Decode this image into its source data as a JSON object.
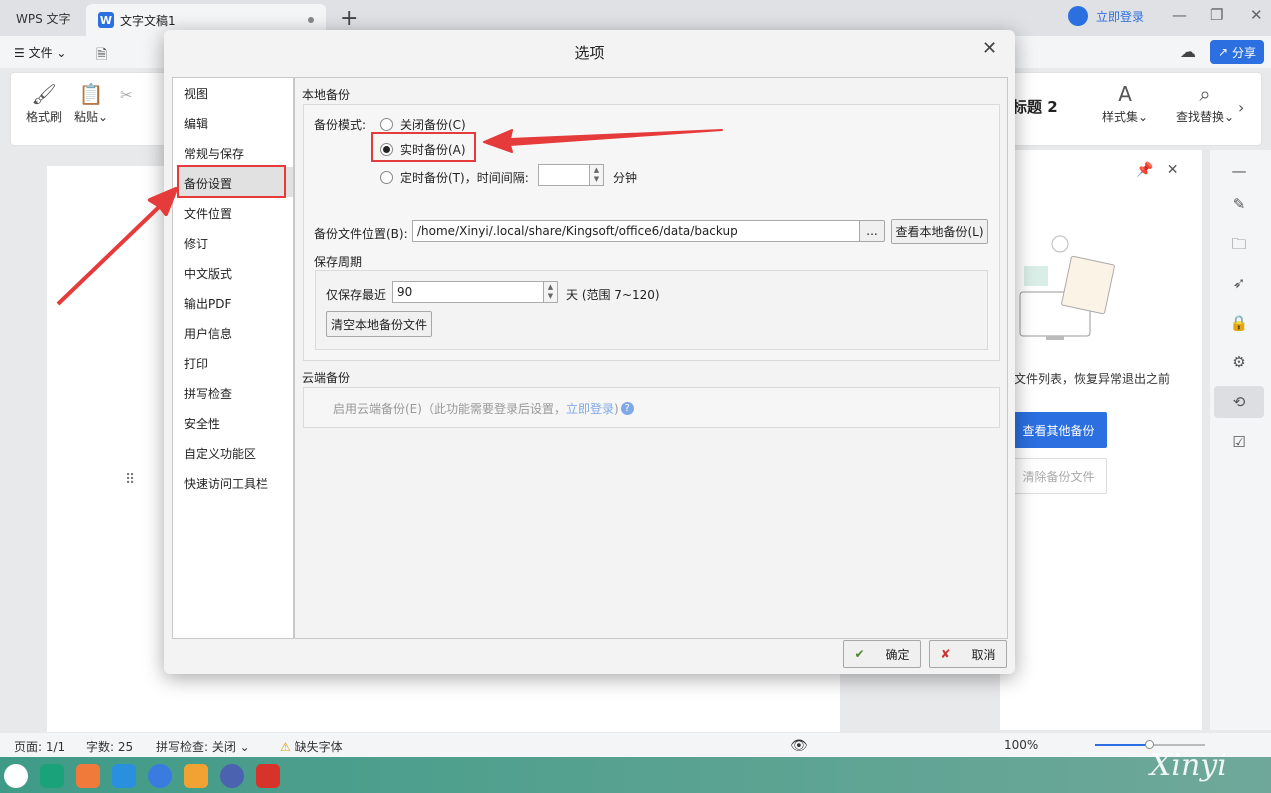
{
  "titlebar": {
    "app_tab": "WPS 文字",
    "doc_tab": "文字文稿1",
    "doc_logo": "W",
    "login": "立即登录"
  },
  "menubar": {
    "file_label": "☰ 文件 ⌄",
    "share_label": "分享"
  },
  "ribbon": {
    "format_painter": "格式刷",
    "paste": "粘贴⌄",
    "heading_style": "标题  2",
    "style_set": "样式集⌄",
    "find_replace": "查找替换⌄"
  },
  "taskpane": {
    "description": "文件列表，恢复异常退出之前",
    "view_other_backup": "查看其他备份",
    "clear_backup": "清除备份文件"
  },
  "status": {
    "page": "页面: 1/1",
    "words": "字数: 25",
    "spellcheck": "拼写检查: 关闭 ⌄",
    "missing_font": "缺失字体",
    "zoom": "100%"
  },
  "watermark": "Xinyi",
  "dialog": {
    "title": "选项",
    "nav": [
      "视图",
      "编辑",
      "常规与保存",
      "备份设置",
      "文件位置",
      "修订",
      "中文版式",
      "输出PDF",
      "用户信息",
      "打印",
      "拼写检查",
      "安全性",
      "自定义功能区",
      "快速访问工具栏"
    ],
    "local_backup_title": "本地备份",
    "backup_mode_label": "备份模式:",
    "mode_off": "关闭备份(C)",
    "mode_realtime": "实时备份(A)",
    "mode_timed": "定时备份(T)，时间间隔:",
    "minutes_unit": "分钟",
    "location_label": "备份文件位置(B):",
    "location_value": "/home/Xinyi/.local/share/Kingsoft/office6/data/backup",
    "browse": "...",
    "view_local_backup": "查看本地备份(L)",
    "retention_title": "保存周期",
    "keep_recent_label": "仅保存最近",
    "keep_recent_value": "90",
    "days_range": "天 (范围 7~120)",
    "clear_local": "清空本地备份文件",
    "cloud_title": "云端备份",
    "cloud_enable": "启用云端备份(E)（此功能需要登录后设置，",
    "cloud_login_link": "立即登录",
    "cloud_close_paren": ")",
    "ok": "确定",
    "cancel": "取消"
  }
}
